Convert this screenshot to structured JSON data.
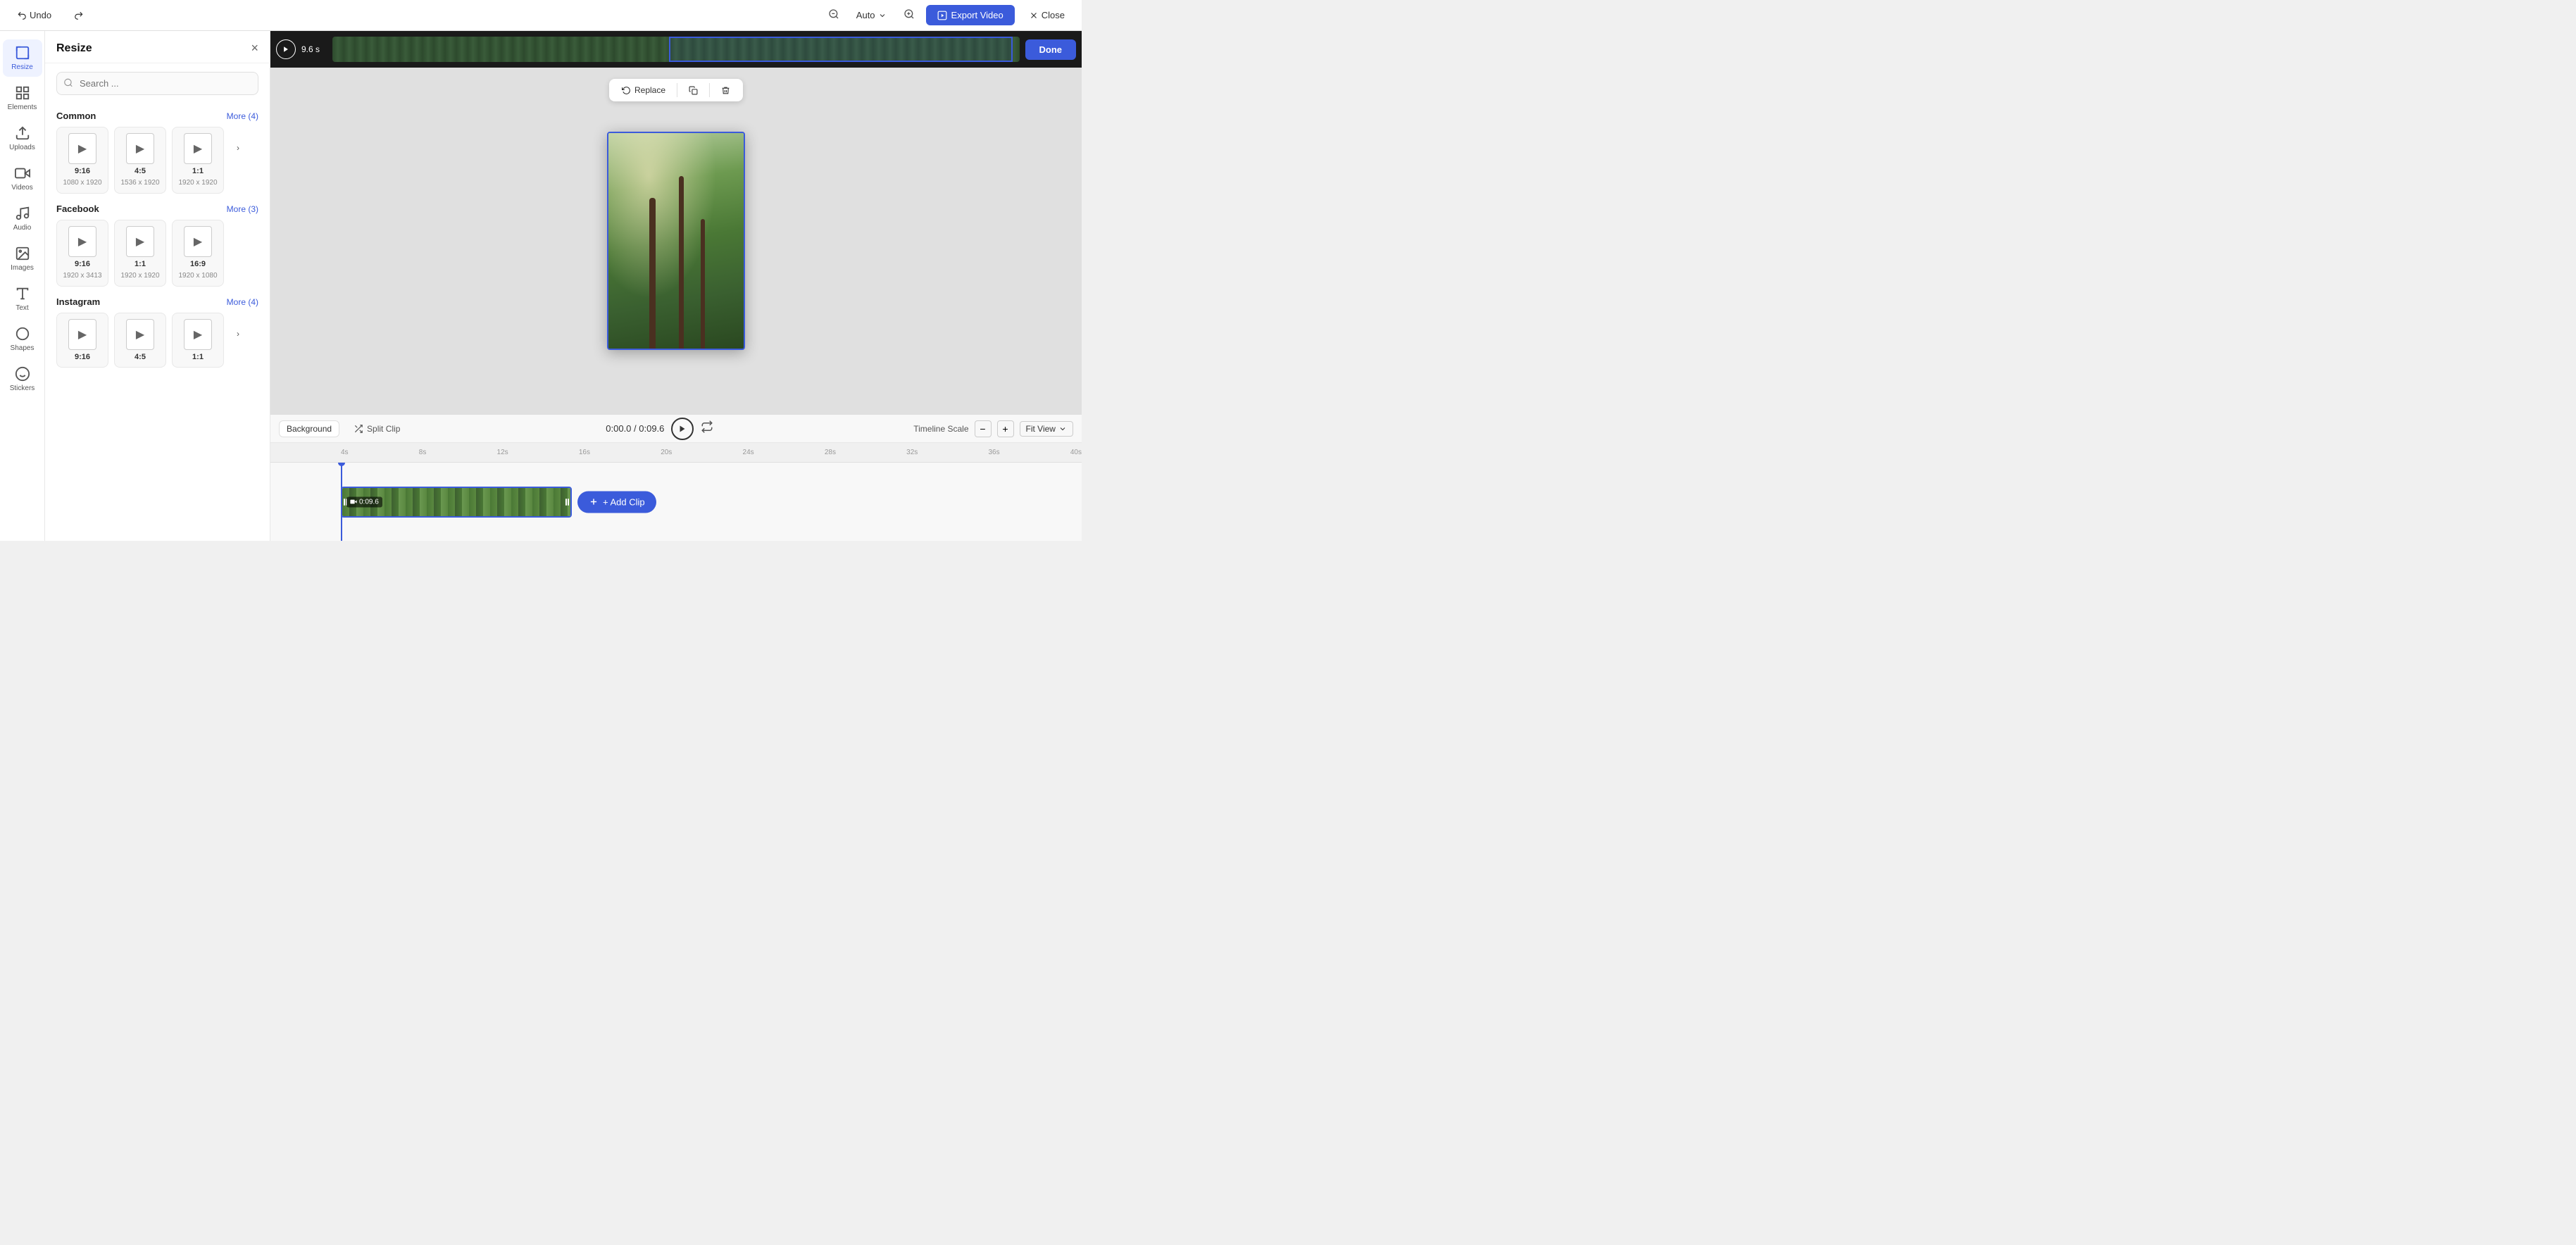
{
  "topbar": {
    "undo_label": "Undo",
    "redo_label": "",
    "auto_label": "Auto",
    "export_label": "Export Video",
    "close_label": "Close"
  },
  "left_sidebar": {
    "items": [
      {
        "id": "resize",
        "label": "Resize",
        "icon": "resize-icon",
        "active": true
      },
      {
        "id": "elements",
        "label": "Elements",
        "icon": "elements-icon",
        "active": false
      },
      {
        "id": "uploads",
        "label": "Uploads",
        "icon": "uploads-icon",
        "active": false
      },
      {
        "id": "videos",
        "label": "Videos",
        "icon": "videos-icon",
        "active": false
      },
      {
        "id": "audio",
        "label": "Audio",
        "icon": "audio-icon",
        "active": false
      },
      {
        "id": "images",
        "label": "Images",
        "icon": "images-icon",
        "active": false
      },
      {
        "id": "text",
        "label": "Text",
        "icon": "text-icon",
        "active": false
      },
      {
        "id": "shapes",
        "label": "Shapes",
        "icon": "shapes-icon",
        "active": false
      },
      {
        "id": "stickers",
        "label": "Stickers",
        "icon": "stickers-icon",
        "active": false
      }
    ]
  },
  "resize_panel": {
    "title": "Resize",
    "search_placeholder": "Search ...",
    "sections": [
      {
        "id": "common",
        "title": "Common",
        "more_label": "More (4)",
        "cards": [
          {
            "ratio": "9:16",
            "dims": "1080 x 1920",
            "icon": "▶"
          },
          {
            "ratio": "4:5",
            "dims": "1536 x 1920",
            "icon": "▶"
          },
          {
            "ratio": "1:1",
            "dims": "1920 x 1920",
            "icon": "▶"
          }
        ],
        "has_more_arrow": true
      },
      {
        "id": "facebook",
        "title": "Facebook",
        "more_label": "More (3)",
        "cards": [
          {
            "ratio": "9:16",
            "dims": "1920 x 3413",
            "icon": "▶"
          },
          {
            "ratio": "1:1",
            "dims": "1920 x 1920",
            "icon": "▶"
          },
          {
            "ratio": "16:9",
            "dims": "1920 x 1080",
            "icon": "▶"
          }
        ],
        "has_more_arrow": false
      },
      {
        "id": "instagram",
        "title": "Instagram",
        "more_label": "More (4)",
        "cards": [
          {
            "ratio": "9:16",
            "dims": "",
            "icon": "▶"
          },
          {
            "ratio": "4:5",
            "dims": "",
            "icon": "▶"
          },
          {
            "ratio": "1:1",
            "dims": "",
            "icon": "▶"
          }
        ],
        "has_more_arrow": true
      }
    ]
  },
  "filmstrip": {
    "play_icon": "▶",
    "time_label": "9.6 s",
    "done_label": "Done"
  },
  "action_toolbar": {
    "replace_label": "Replace",
    "copy_label": "",
    "delete_label": ""
  },
  "timeline_toolbar": {
    "background_label": "Background",
    "split_clip_label": "Split Clip",
    "time_display": "0:00.0 / 0:09.6",
    "play_icon": "▶",
    "loop_icon": "↺",
    "scale_label": "Timeline Scale",
    "minus_label": "−",
    "plus_label": "+",
    "fit_view_label": "Fit View"
  },
  "timeline": {
    "ruler_marks": [
      "4s",
      "8s",
      "12s",
      "16s",
      "20s",
      "24s",
      "28s",
      "32s",
      "36s",
      "40s"
    ],
    "clip_duration": "0:09.6",
    "clip_icon": "▶",
    "add_clip_label": "+ Add Clip"
  }
}
